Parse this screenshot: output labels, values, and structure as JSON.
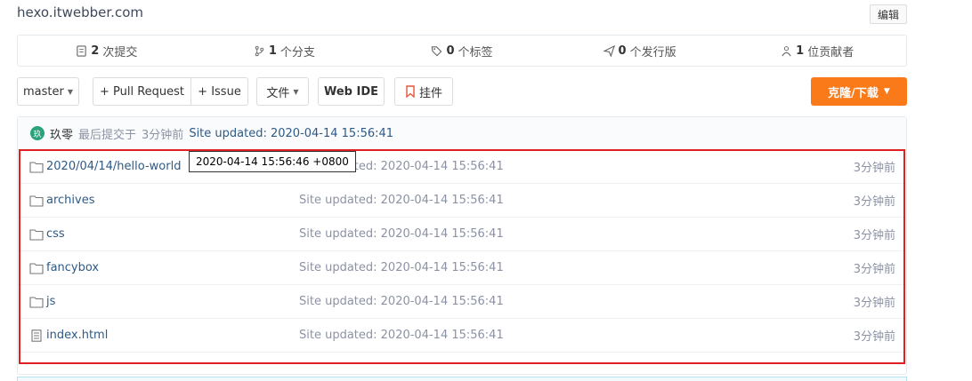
{
  "repo": {
    "description": "hexo.itwebber.com",
    "edit_label": "编辑"
  },
  "stats": [
    {
      "count": "2",
      "label": "次提交",
      "icon": "commit-icon"
    },
    {
      "count": "1",
      "label": "个分支",
      "icon": "branch-icon"
    },
    {
      "count": "0",
      "label": "个标签",
      "icon": "tag-icon"
    },
    {
      "count": "0",
      "label": "个发行版",
      "icon": "release-icon"
    },
    {
      "count": "1",
      "label": "位贡献者",
      "icon": "contributor-icon"
    }
  ],
  "toolbar": {
    "branch": "master",
    "pull_request": "+ Pull Request",
    "issue": "+ Issue",
    "file_menu": "文件",
    "web_ide": "Web IDE",
    "pin": "挂件",
    "clone": "克隆/下载",
    "clone_color": "#fa7a1a"
  },
  "last_commit": {
    "avatar_letter": "玖",
    "author": "玖零",
    "prefix": "最后提交于",
    "time": "3分钟前",
    "message": "Site updated: 2020-04-14 15:56:41"
  },
  "files": [
    {
      "type": "folder",
      "name": "2020/04/14/hello-world",
      "message": "Site updated: 2020-04-14 15:56:41",
      "time": "3分钟前"
    },
    {
      "type": "folder",
      "name": "archives",
      "message": "Site updated: 2020-04-14 15:56:41",
      "time": "3分钟前"
    },
    {
      "type": "folder",
      "name": "css",
      "message": "Site updated: 2020-04-14 15:56:41",
      "time": "3分钟前"
    },
    {
      "type": "folder",
      "name": "fancybox",
      "message": "Site updated: 2020-04-14 15:56:41",
      "time": "3分钟前"
    },
    {
      "type": "folder",
      "name": "js",
      "message": "Site updated: 2020-04-14 15:56:41",
      "time": "3分钟前"
    },
    {
      "type": "file",
      "name": "index.html",
      "message": "Site updated: 2020-04-14 15:56:41",
      "time": "3分钟前"
    }
  ],
  "tooltip": "2020-04-14 15:56:46 +0800",
  "colors": {
    "link": "#2e5a87",
    "highlight_border": "#e02020"
  }
}
